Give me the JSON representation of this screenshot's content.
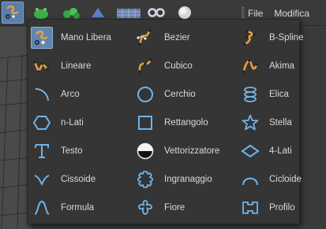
{
  "menubar": {
    "file_label": "File",
    "modifica_label": "Modifica"
  },
  "toolbar": {
    "buttons": [
      {
        "icon": "freehand-spline-icon",
        "active": true
      },
      {
        "icon": "green-object-icon"
      },
      {
        "icon": "green-cluster-icon"
      },
      {
        "icon": "blue-shape-icon"
      },
      {
        "icon": "floor-icon"
      },
      {
        "icon": "infinity-icon"
      },
      {
        "icon": "sphere-icon"
      }
    ]
  },
  "menu": {
    "columns": [
      [
        {
          "label": "Mano Libera",
          "icon": "freehand-icon",
          "selected": true
        },
        {
          "label": "Lineare",
          "icon": "linear-spline-icon"
        },
        {
          "label": "Arco",
          "icon": "arc-icon"
        },
        {
          "label": "n-Lati",
          "icon": "hexagon-icon"
        },
        {
          "label": "Testo",
          "icon": "text-icon"
        },
        {
          "label": "Cissoide",
          "icon": "cissoid-icon"
        },
        {
          "label": "Formula",
          "icon": "formula-icon"
        }
      ],
      [
        {
          "label": "Bezier",
          "icon": "bezier-icon"
        },
        {
          "label": "Cubico",
          "icon": "cubic-spline-icon"
        },
        {
          "label": "Cerchio",
          "icon": "circle-icon"
        },
        {
          "label": "Rettangolo",
          "icon": "rectangle-icon"
        },
        {
          "label": "Vettorizzatore",
          "icon": "vectorizer-icon"
        },
        {
          "label": "Ingranaggio",
          "icon": "gear-icon"
        },
        {
          "label": "Fiore",
          "icon": "flower-icon"
        }
      ],
      [
        {
          "label": "B-Spline",
          "icon": "b-spline-icon"
        },
        {
          "label": "Akima",
          "icon": "akima-icon"
        },
        {
          "label": "Elica",
          "icon": "helix-icon"
        },
        {
          "label": "Stella",
          "icon": "star-icon"
        },
        {
          "label": "4-Lati",
          "icon": "four-side-icon"
        },
        {
          "label": "Cicloide",
          "icon": "cycloid-icon"
        },
        {
          "label": "Profilo",
          "icon": "profile-icon"
        }
      ]
    ]
  },
  "colors": {
    "accent": "#6fb3e8",
    "spline_orange": "#e8a040",
    "selected_bg": "#5f86b0"
  }
}
